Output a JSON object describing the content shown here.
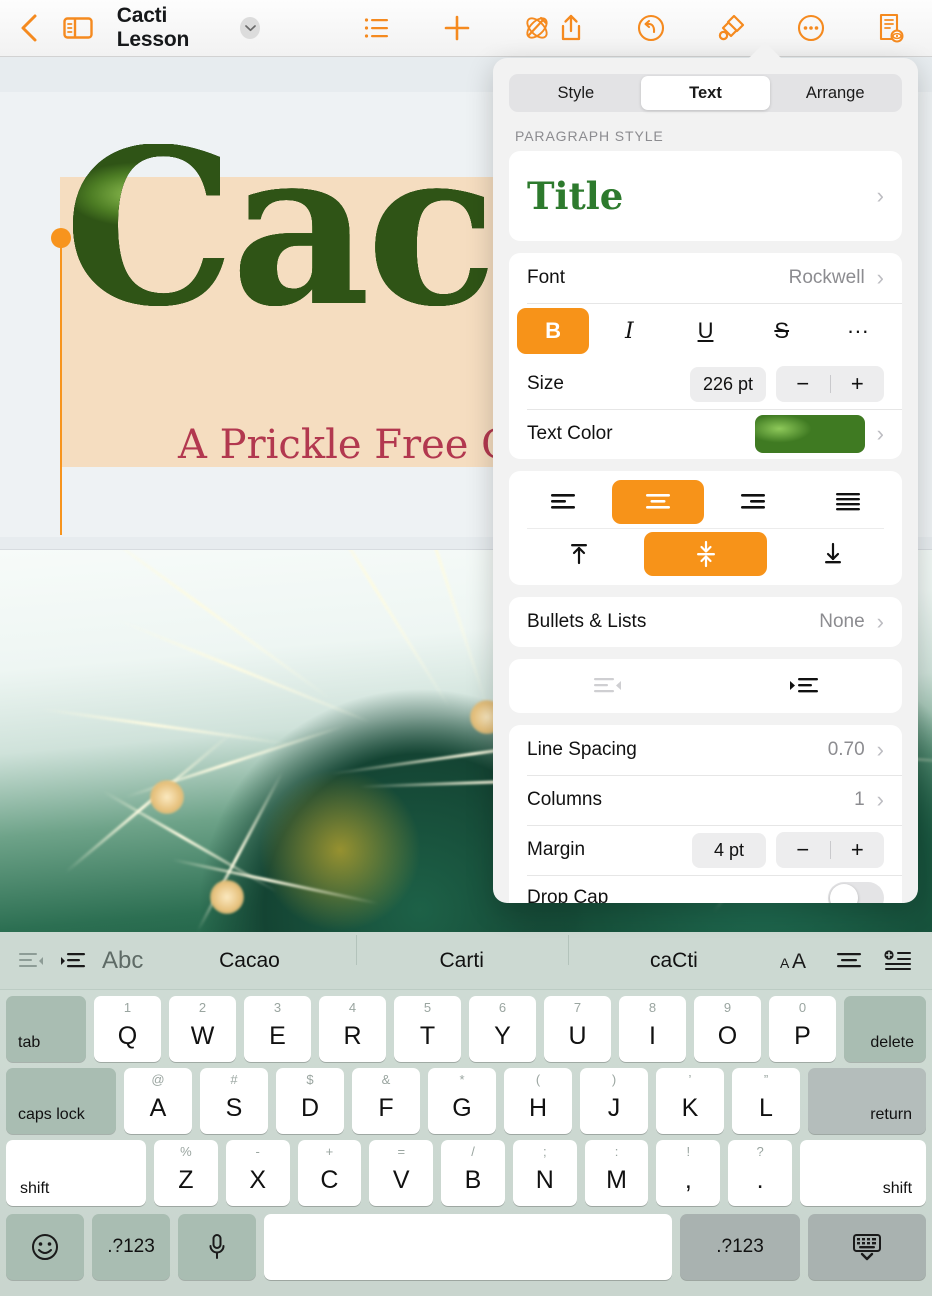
{
  "toolbar": {
    "back_label": "Back",
    "sidebar_label": "Sidebar",
    "document_title": "Cacti Lesson",
    "title_menu_label": "Document Options",
    "list_label": "Table of Contents",
    "insert_label": "Insert",
    "smart_annotation_label": "Smart Annotation",
    "share_label": "Share",
    "undo_label": "Undo",
    "format_label": "Format",
    "more_label": "More",
    "view_label": "Document Setup"
  },
  "canvas": {
    "title_text": "Cacti",
    "subtitle_text": "A Prickle Free Guide",
    "photo_alt": "Close-up photo of a cactus with yellow flower and spines"
  },
  "inspector": {
    "tabs": [
      {
        "label": "Style",
        "active": false
      },
      {
        "label": "Text",
        "active": true
      },
      {
        "label": "Arrange",
        "active": false
      }
    ],
    "paragraph_style_header": "PARAGRAPH STYLE",
    "paragraph_style_value": "Title",
    "font": {
      "label": "Font",
      "value": "Rockwell"
    },
    "format_buttons": [
      {
        "label": "B",
        "name": "bold",
        "active": true
      },
      {
        "label": "I",
        "name": "italic",
        "active": false
      },
      {
        "label": "U",
        "name": "underline",
        "active": false
      },
      {
        "label": "S",
        "name": "strikethrough",
        "active": false
      },
      {
        "label": "···",
        "name": "more-text-options",
        "active": false
      }
    ],
    "size": {
      "label": "Size",
      "value": "226 pt",
      "decrement": "−",
      "increment": "+"
    },
    "text_color": {
      "label": "Text Color"
    },
    "alignment": {
      "horizontal": [
        {
          "name": "align-left",
          "active": false
        },
        {
          "name": "align-center",
          "active": true
        },
        {
          "name": "align-right",
          "active": false
        },
        {
          "name": "align-justify",
          "active": false
        }
      ],
      "vertical": [
        {
          "name": "align-top",
          "active": false
        },
        {
          "name": "align-middle",
          "active": true
        },
        {
          "name": "align-bottom",
          "active": false
        }
      ]
    },
    "bullets": {
      "label": "Bullets & Lists",
      "value": "None"
    },
    "indent": [
      {
        "name": "decrease-indent",
        "enabled": false
      },
      {
        "name": "increase-indent",
        "enabled": true
      }
    ],
    "line_spacing": {
      "label": "Line Spacing",
      "value": "0.70"
    },
    "columns": {
      "label": "Columns",
      "value": "1"
    },
    "margin": {
      "label": "Margin",
      "value": "4 pt",
      "decrement": "−",
      "increment": "+"
    },
    "partial_row_label": "Drop Cap"
  },
  "keyboard": {
    "predictive": {
      "suggestions": [
        "Cacao",
        "Carti",
        "caCti"
      ],
      "abc_label": "Abc",
      "left_icons": [
        "outdent-icon",
        "indent-icon"
      ],
      "right_icons": [
        "text-size-icon",
        "align-icon",
        "insert-list-icon"
      ]
    },
    "row1": {
      "left_mod": "tab",
      "keys": [
        {
          "alt": "1",
          "main": "Q"
        },
        {
          "alt": "2",
          "main": "W"
        },
        {
          "alt": "3",
          "main": "E"
        },
        {
          "alt": "4",
          "main": "R"
        },
        {
          "alt": "5",
          "main": "T"
        },
        {
          "alt": "6",
          "main": "Y"
        },
        {
          "alt": "7",
          "main": "U"
        },
        {
          "alt": "8",
          "main": "I"
        },
        {
          "alt": "9",
          "main": "O"
        },
        {
          "alt": "0",
          "main": "P"
        }
      ],
      "right_mod": "delete"
    },
    "row2": {
      "left_mod": "caps lock",
      "keys": [
        {
          "alt": "@",
          "main": "A"
        },
        {
          "alt": "#",
          "main": "S"
        },
        {
          "alt": "$",
          "main": "D"
        },
        {
          "alt": "&",
          "main": "F"
        },
        {
          "alt": "*",
          "main": "G"
        },
        {
          "alt": "(",
          "main": "H"
        },
        {
          "alt": ")",
          "main": "J"
        },
        {
          "alt": "’",
          "main": "K"
        },
        {
          "alt": "”",
          "main": "L"
        }
      ],
      "right_mod": "return"
    },
    "row3": {
      "left_mod": "shift",
      "keys": [
        {
          "alt": "%",
          "main": "Z"
        },
        {
          "alt": "-",
          "main": "X"
        },
        {
          "alt": "+",
          "main": "C"
        },
        {
          "alt": "=",
          "main": "V"
        },
        {
          "alt": "/",
          "main": "B"
        },
        {
          "alt": ";",
          "main": "N"
        },
        {
          "alt": ":",
          "main": "M"
        },
        {
          "alt": "!",
          "main": ","
        },
        {
          "alt": "?",
          "main": "."
        }
      ],
      "right_mod": "shift"
    },
    "row4": {
      "emoji_label": "emoji-icon",
      "numeric_left": ".?123",
      "mic_label": "microphone-icon",
      "space_label": "",
      "numeric_right": ".?123",
      "dismiss_label": "hide-keyboard-icon"
    }
  },
  "colors": {
    "accent_orange": "#f7941d",
    "title_green": "#2d7a2d",
    "subtitle_red": "#b2384f",
    "slide_bg": "#f5ddc0",
    "keyboard_bg": "#cfdcd5"
  }
}
